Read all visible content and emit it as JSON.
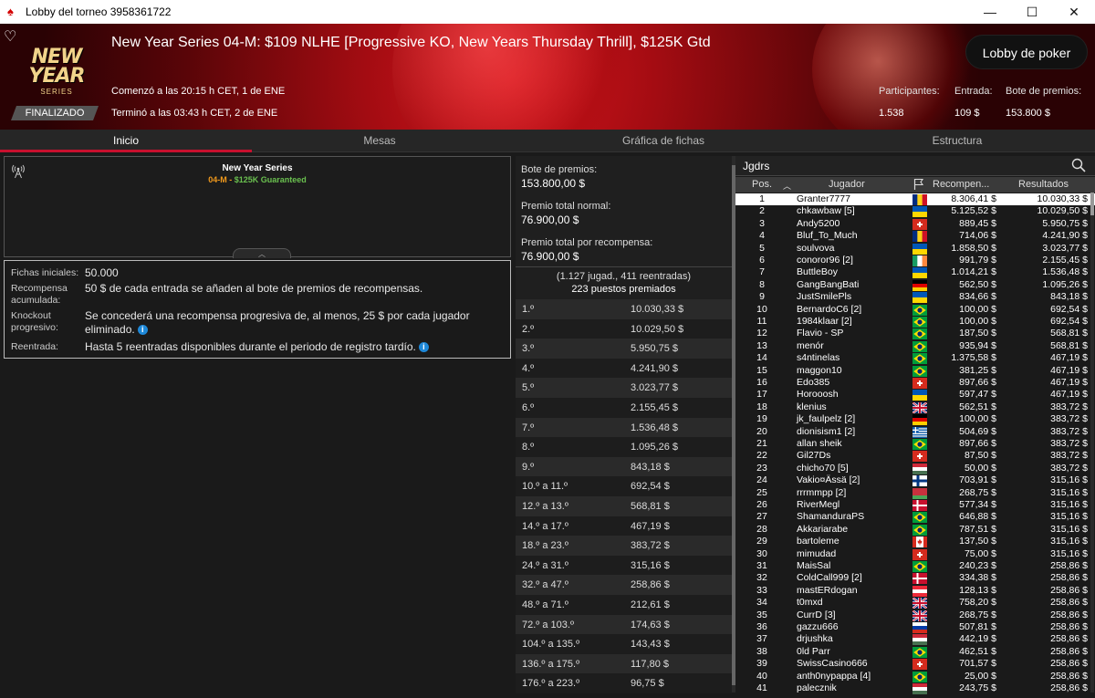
{
  "window": {
    "title": "Lobby del torneo 3958361722",
    "minimize": "—",
    "maximize": "☐",
    "close": "✕"
  },
  "header": {
    "logo": {
      "line1": "NEW",
      "line2": "YEAR",
      "line3": "SERIES"
    },
    "title": "New Year Series 04-M: $109 NLHE [Progressive KO, New Years Thursday Thrill], $125K Gtd",
    "started": "Comenzó a las 20:15 h CET, 1 de ENE",
    "ended": "Terminó a las 03:43 h CET, 2 de ENE",
    "status": "FINALIZADO",
    "lobby_button": "Lobby de poker",
    "participants_label": "Participantes:",
    "participants_value": "1.538",
    "entry_label": "Entrada:",
    "entry_value": "109 $",
    "prizepool_label": "Bote de premios:",
    "prizepool_value": "153.800 $"
  },
  "tabs": [
    {
      "label": "Inicio",
      "active": true
    },
    {
      "label": "Mesas"
    },
    {
      "label": "Gráfica de fichas"
    },
    {
      "label": "Estructura"
    }
  ],
  "info": {
    "series": "New Year Series",
    "sub_code": "04-M",
    "sub_sep": " - ",
    "sub_guarantee": "$125K Guaranteed",
    "collapse": "︿"
  },
  "rules": [
    {
      "label": "Fichas iniciales:",
      "value": "50.000"
    },
    {
      "label": "Recompensa acumulada:",
      "value": "50 $ de cada entrada se añaden al bote de premios de recompensas."
    },
    {
      "label": "Knockout progresivo:",
      "value": "Se concederá una recompensa progresiva de, al menos, 25 $ por cada jugador eliminado."
    },
    {
      "label": "Reentrada:",
      "value": "Hasta 5 reentradas disponibles durante el periodo de registro tardío."
    }
  ],
  "prize": {
    "pool_label": "Bote de premios:",
    "pool_value": "153.800,00 $",
    "normal_label": "Premio total normal:",
    "normal_value": "76.900,00 $",
    "bounty_label": "Premio total por recompensa:",
    "bounty_value": "76.900,00 $",
    "counts": "(1.127 jugad., 411 reentradas)",
    "paid": "223 puestos premiados",
    "rows": [
      [
        "1.º",
        "10.030,33 $"
      ],
      [
        "2.º",
        "10.029,50 $"
      ],
      [
        "3.º",
        "5.950,75 $"
      ],
      [
        "4.º",
        "4.241,90 $"
      ],
      [
        "5.º",
        "3.023,77 $"
      ],
      [
        "6.º",
        "2.155,45 $"
      ],
      [
        "7.º",
        "1.536,48 $"
      ],
      [
        "8.º",
        "1.095,26 $"
      ],
      [
        "9.º",
        "843,18 $"
      ],
      [
        "10.º a 11.º",
        "692,54 $"
      ],
      [
        "12.º a 13.º",
        "568,81 $"
      ],
      [
        "14.º a 17.º",
        "467,19 $"
      ],
      [
        "18.º a 23.º",
        "383,72 $"
      ],
      [
        "24.º a 31.º",
        "315,16 $"
      ],
      [
        "32.º a 47.º",
        "258,86 $"
      ],
      [
        "48.º a 71.º",
        "212,61 $"
      ],
      [
        "72.º a 103.º",
        "174,63 $"
      ],
      [
        "104.º a 135.º",
        "143,43 $"
      ],
      [
        "136.º a 175.º",
        "117,80 $"
      ],
      [
        "176.º a 223.º",
        "96,75 $"
      ]
    ]
  },
  "players": {
    "title": "Jgdrs",
    "headers": {
      "pos": "Pos.",
      "sort": "︿",
      "player": "Jugador",
      "bounty": "Recompen...",
      "results": "Resultados"
    },
    "rows": [
      [
        "1",
        "Granter7777",
        "ro",
        "8.306,41 $",
        "10.030,33 $"
      ],
      [
        "2",
        "chkawbaw [5]",
        "ua",
        "5.125,52 $",
        "10.029,50 $"
      ],
      [
        "3",
        "Andy5200",
        "ch",
        "889,45 $",
        "5.950,75 $"
      ],
      [
        "4",
        "Bluf_To_Much",
        "ro",
        "714,06 $",
        "4.241,90 $"
      ],
      [
        "5",
        "soulvova",
        "ua",
        "1.858,50 $",
        "3.023,77 $"
      ],
      [
        "6",
        "conoror96 [2]",
        "ie",
        "991,79 $",
        "2.155,45 $"
      ],
      [
        "7",
        "ButtleBoy",
        "ua",
        "1.014,21 $",
        "1.536,48 $"
      ],
      [
        "8",
        "GangBangBati",
        "de",
        "562,50 $",
        "1.095,26 $"
      ],
      [
        "9",
        "JustSmilePls",
        "ua",
        "834,66 $",
        "843,18 $"
      ],
      [
        "10",
        "BernardoC6 [2]",
        "br",
        "100,00 $",
        "692,54 $"
      ],
      [
        "11",
        "1984klaar [2]",
        "br",
        "100,00 $",
        "692,54 $"
      ],
      [
        "12",
        "Flavio - SP",
        "br",
        "187,50 $",
        "568,81 $"
      ],
      [
        "13",
        "menór",
        "br",
        "935,94 $",
        "568,81 $"
      ],
      [
        "14",
        "s4ntinelas",
        "br",
        "1.375,58 $",
        "467,19 $"
      ],
      [
        "15",
        "maggon10",
        "br",
        "381,25 $",
        "467,19 $"
      ],
      [
        "16",
        "Edo385",
        "ch",
        "897,66 $",
        "467,19 $"
      ],
      [
        "17",
        "Horooosh",
        "ua",
        "597,47 $",
        "467,19 $"
      ],
      [
        "18",
        "klenius",
        "gb",
        "562,51 $",
        "383,72 $"
      ],
      [
        "19",
        "jk_faulpelz [2]",
        "de",
        "100,00 $",
        "383,72 $"
      ],
      [
        "20",
        "dionisism1 [2]",
        "gr",
        "504,69 $",
        "383,72 $"
      ],
      [
        "21",
        "allan sheik",
        "br",
        "897,66 $",
        "383,72 $"
      ],
      [
        "22",
        "Gil27Ds",
        "ch",
        "87,50 $",
        "383,72 $"
      ],
      [
        "23",
        "chicho70 [5]",
        "hu",
        "50,00 $",
        "383,72 $"
      ],
      [
        "24",
        "Vakio¤Ässä [2]",
        "fi",
        "703,91 $",
        "315,16 $"
      ],
      [
        "25",
        "rrrmmpp [2]",
        "by",
        "268,75 $",
        "315,16 $"
      ],
      [
        "26",
        "RiverMegl",
        "dk",
        "577,34 $",
        "315,16 $"
      ],
      [
        "27",
        "ShamanduraPS",
        "br",
        "646,88 $",
        "315,16 $"
      ],
      [
        "28",
        "Akkariarabe",
        "br",
        "787,51 $",
        "315,16 $"
      ],
      [
        "29",
        "bartoleme",
        "ca",
        "137,50 $",
        "315,16 $"
      ],
      [
        "30",
        "mimudad",
        "ch",
        "75,00 $",
        "315,16 $"
      ],
      [
        "31",
        "MaisSal",
        "br",
        "240,23 $",
        "258,86 $"
      ],
      [
        "32",
        "ColdCall999 [2]",
        "dk",
        "334,38 $",
        "258,86 $"
      ],
      [
        "33",
        "mastERdogan",
        "at",
        "128,13 $",
        "258,86 $"
      ],
      [
        "34",
        "t0mxd",
        "gb",
        "758,20 $",
        "258,86 $"
      ],
      [
        "35",
        "CurrD [3]",
        "gb",
        "268,75 $",
        "258,86 $"
      ],
      [
        "36",
        "gazzu666",
        "ru",
        "507,81 $",
        "258,86 $"
      ],
      [
        "37",
        "drjushka",
        "hu",
        "442,19 $",
        "258,86 $"
      ],
      [
        "38",
        "0ld Parr",
        "br",
        "462,51 $",
        "258,86 $"
      ],
      [
        "39",
        "SwissCasino666",
        "ch",
        "701,57 $",
        "258,86 $"
      ],
      [
        "40",
        "anth0nypappa [4]",
        "br",
        "25,00 $",
        "258,86 $"
      ],
      [
        "41",
        "palecznik",
        "hu",
        "243,75 $",
        "258,86 $"
      ]
    ]
  }
}
